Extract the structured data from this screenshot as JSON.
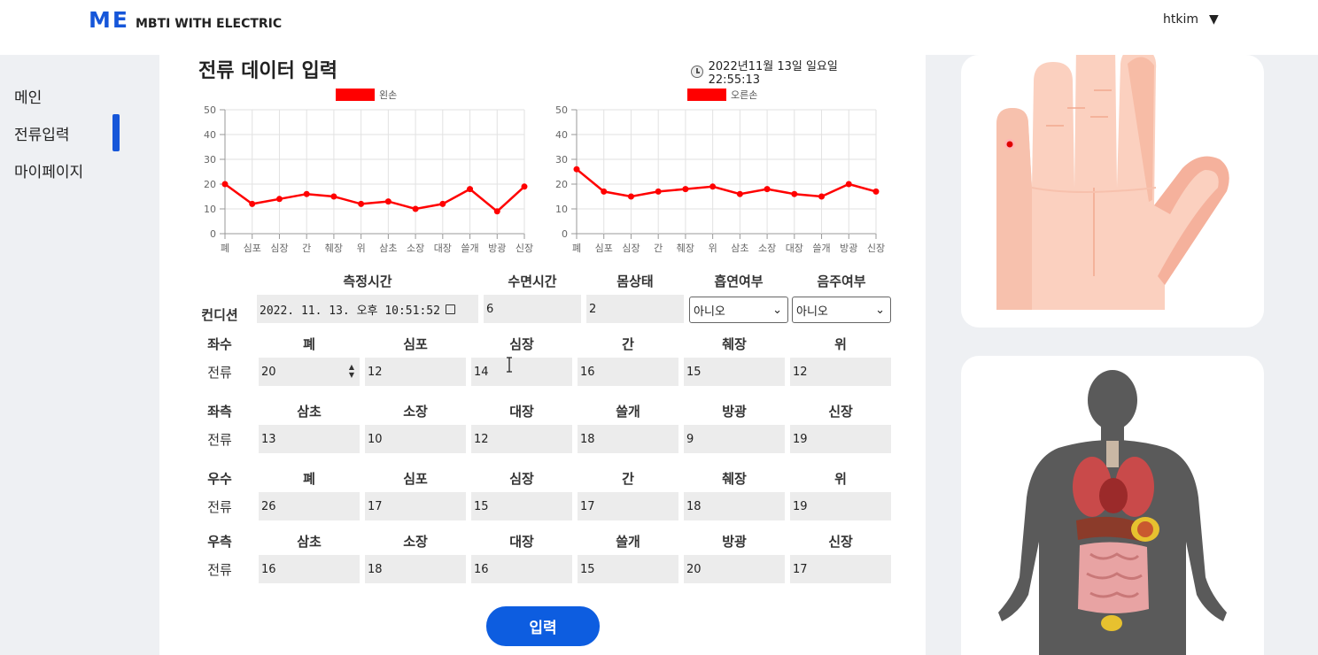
{
  "header": {
    "logo_mark": "ME",
    "logo_text": "MBTI WITH ELECTRIC",
    "user": "htkim",
    "caret": "▼"
  },
  "sidebar": {
    "items": [
      {
        "label": "메인"
      },
      {
        "label": "전류입력"
      },
      {
        "label": "마이페이지"
      }
    ],
    "active_index": 1
  },
  "page": {
    "title": "전류 데이터 입력",
    "datetime": "2022년11월 13일 일요일 22:55:13"
  },
  "colors": {
    "accent": "#1656d9",
    "button": "#0d5de0",
    "series": "#ff0000"
  },
  "chart_data": [
    {
      "type": "line",
      "legend": "왼손",
      "categories": [
        "폐",
        "심포",
        "심장",
        "간",
        "췌장",
        "위",
        "삼초",
        "소장",
        "대장",
        "쓸개",
        "방광",
        "신장"
      ],
      "values": [
        20,
        12,
        14,
        16,
        15,
        12,
        13,
        10,
        12,
        18,
        9,
        19
      ],
      "ylim": [
        0,
        50
      ],
      "yticks": [
        0,
        10,
        20,
        30,
        40,
        50
      ],
      "grid": true,
      "legend_position": "top"
    },
    {
      "type": "line",
      "legend": "오른손",
      "categories": [
        "폐",
        "심포",
        "심장",
        "간",
        "췌장",
        "위",
        "삼초",
        "소장",
        "대장",
        "쓸개",
        "방광",
        "신장"
      ],
      "values": [
        26,
        17,
        15,
        17,
        18,
        19,
        16,
        18,
        16,
        15,
        20,
        17
      ],
      "ylim": [
        0,
        50
      ],
      "yticks": [
        0,
        10,
        20,
        30,
        40,
        50
      ],
      "grid": true,
      "legend_position": "top"
    }
  ],
  "condition": {
    "row_label": "컨디션",
    "headers": {
      "measure_time": "측정시간",
      "sleep_time": "수면시간",
      "body_state": "몸상태",
      "smoking": "흡연여부",
      "drinking": "음주여부"
    },
    "measure_time_value": "2022. 11. 13. 오후 10:51:52",
    "sleep_time_value": "6",
    "body_state_value": "2",
    "smoking_value": "아니오",
    "drinking_value": "아니오"
  },
  "sections": [
    {
      "side": "좌수",
      "row_label": "전류",
      "organs": [
        "폐",
        "심포",
        "심장",
        "간",
        "췌장",
        "위"
      ],
      "values": [
        "20",
        "12",
        "14",
        "16",
        "15",
        "12"
      ]
    },
    {
      "side": "좌측",
      "row_label": "전류",
      "organs": [
        "삼초",
        "소장",
        "대장",
        "쓸개",
        "방광",
        "신장"
      ],
      "values": [
        "13",
        "10",
        "12",
        "18",
        "9",
        "19"
      ]
    },
    {
      "side": "우수",
      "row_label": "전류",
      "organs": [
        "폐",
        "심포",
        "심장",
        "간",
        "췌장",
        "위"
      ],
      "values": [
        "26",
        "17",
        "15",
        "17",
        "18",
        "19"
      ]
    },
    {
      "side": "우측",
      "row_label": "전류",
      "organs": [
        "삼초",
        "소장",
        "대장",
        "쓸개",
        "방광",
        "신장"
      ],
      "values": [
        "16",
        "18",
        "16",
        "15",
        "20",
        "17"
      ]
    }
  ],
  "submit_label": "입력"
}
